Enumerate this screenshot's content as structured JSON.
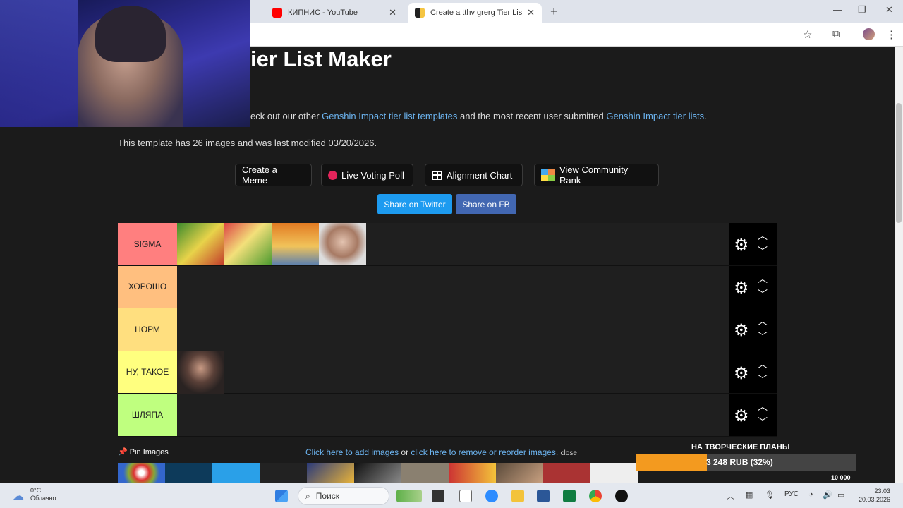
{
  "browser": {
    "tabs": [
      {
        "title": "КИПНИС - YouTube",
        "favicon": "youtube-icon"
      },
      {
        "title": "Create a tthv grerg Tier List - Ti",
        "favicon": "tiermaker-icon"
      }
    ]
  },
  "page": {
    "heading": "ier List Maker",
    "intro": {
      "prefix": "eck out our other ",
      "link1": "Genshin Impact tier list templates",
      "middle": " and the most recent user submitted ",
      "link2": "Genshin Impact tier lists",
      "suffix": "."
    },
    "template_info": "This template has 26 images and was last modified 03/20/2026.",
    "buttons": {
      "meme": "Create a Meme",
      "voting": "Live Voting Poll",
      "alignment": "Alignment Chart",
      "community": "View Community Rank"
    },
    "share": {
      "twitter": "Share on Twitter",
      "fb": "Share on FB"
    },
    "tiers": [
      {
        "label": "SIGMA",
        "color": "#ff7f7f"
      },
      {
        "label": "ХОРОШО",
        "color": "#ffbf7f"
      },
      {
        "label": "НОРМ",
        "color": "#ffdf7f"
      },
      {
        "label": "НУ, ТАКОЕ",
        "color": "#ffff7f"
      },
      {
        "label": "ШЛЯПА",
        "color": "#bfff7f"
      }
    ],
    "pin_images": "Pin Images",
    "add_images": {
      "link1": "Click here to add images",
      "or": " or ",
      "link2": "click here to remove or reorder images",
      "dot": ".",
      "close": "close"
    }
  },
  "donation": {
    "title": "НА ТВОРЧЕСКИЕ ПЛАНЫ",
    "amount": "3 248 RUB (32%)",
    "progress_percent": 32,
    "goal": "10 000"
  },
  "taskbar": {
    "temperature": "0°C",
    "weather": "Облачно",
    "search_placeholder": "Поиск",
    "language": "РУС",
    "time": "23:03",
    "date": "20.03.2026"
  }
}
